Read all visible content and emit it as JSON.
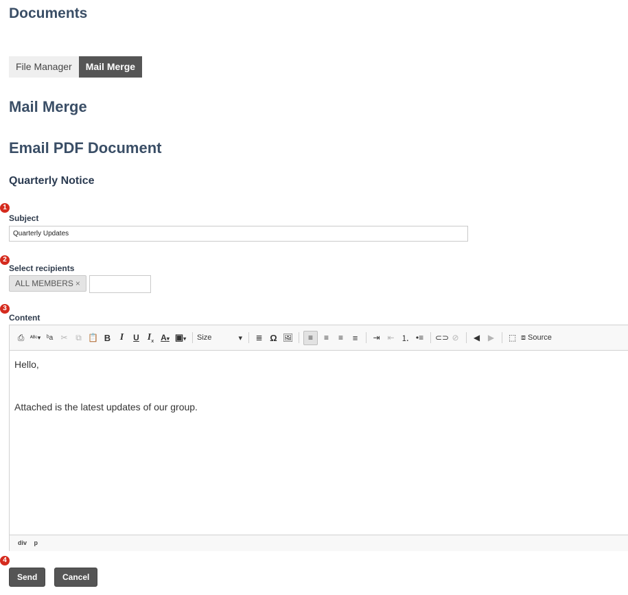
{
  "page_title": "Documents",
  "tabs": [
    {
      "label": "File Manager",
      "active": false
    },
    {
      "label": "Mail Merge",
      "active": true
    }
  ],
  "section_title": "Mail Merge",
  "form_title": "Email PDF Document",
  "document_name": "Quarterly Notice",
  "markers": [
    "1",
    "2",
    "3",
    "4"
  ],
  "subject": {
    "label": "Subject",
    "value": "Quarterly Updates"
  },
  "recipients": {
    "label": "Select recipients",
    "chips": [
      {
        "label": "ALL MEMBERS",
        "remove": "×"
      }
    ],
    "input_value": ""
  },
  "content": {
    "label": "Content",
    "toolbar": {
      "size_label": "Size",
      "source_label": "Source",
      "icons": [
        "print-icon",
        "spellcheck-icon",
        "replace-icon",
        "cut-icon",
        "copy-icon",
        "paste-icon",
        "bold-icon",
        "italic-icon",
        "underline-icon",
        "remove-format-icon",
        "text-color-icon",
        "background-color-icon",
        "horizontal-rule-icon",
        "special-char-icon",
        "image-icon",
        "align-left-icon",
        "align-center-icon",
        "align-right-icon",
        "justify-icon",
        "indent-icon",
        "outdent-icon",
        "numbered-list-icon",
        "bulleted-list-icon",
        "link-icon",
        "unlink-icon",
        "undo-icon",
        "redo-icon",
        "maximize-icon",
        "source-icon"
      ]
    },
    "lines": [
      "Hello,",
      "Attached is the latest updates of our group."
    ],
    "path": [
      "div",
      "p"
    ]
  },
  "buttons": {
    "send": "Send",
    "cancel": "Cancel"
  },
  "colors": {
    "heading": "#3a4e66",
    "active_tab": "#555555",
    "marker": "#d52b1e",
    "button": "#555555"
  }
}
